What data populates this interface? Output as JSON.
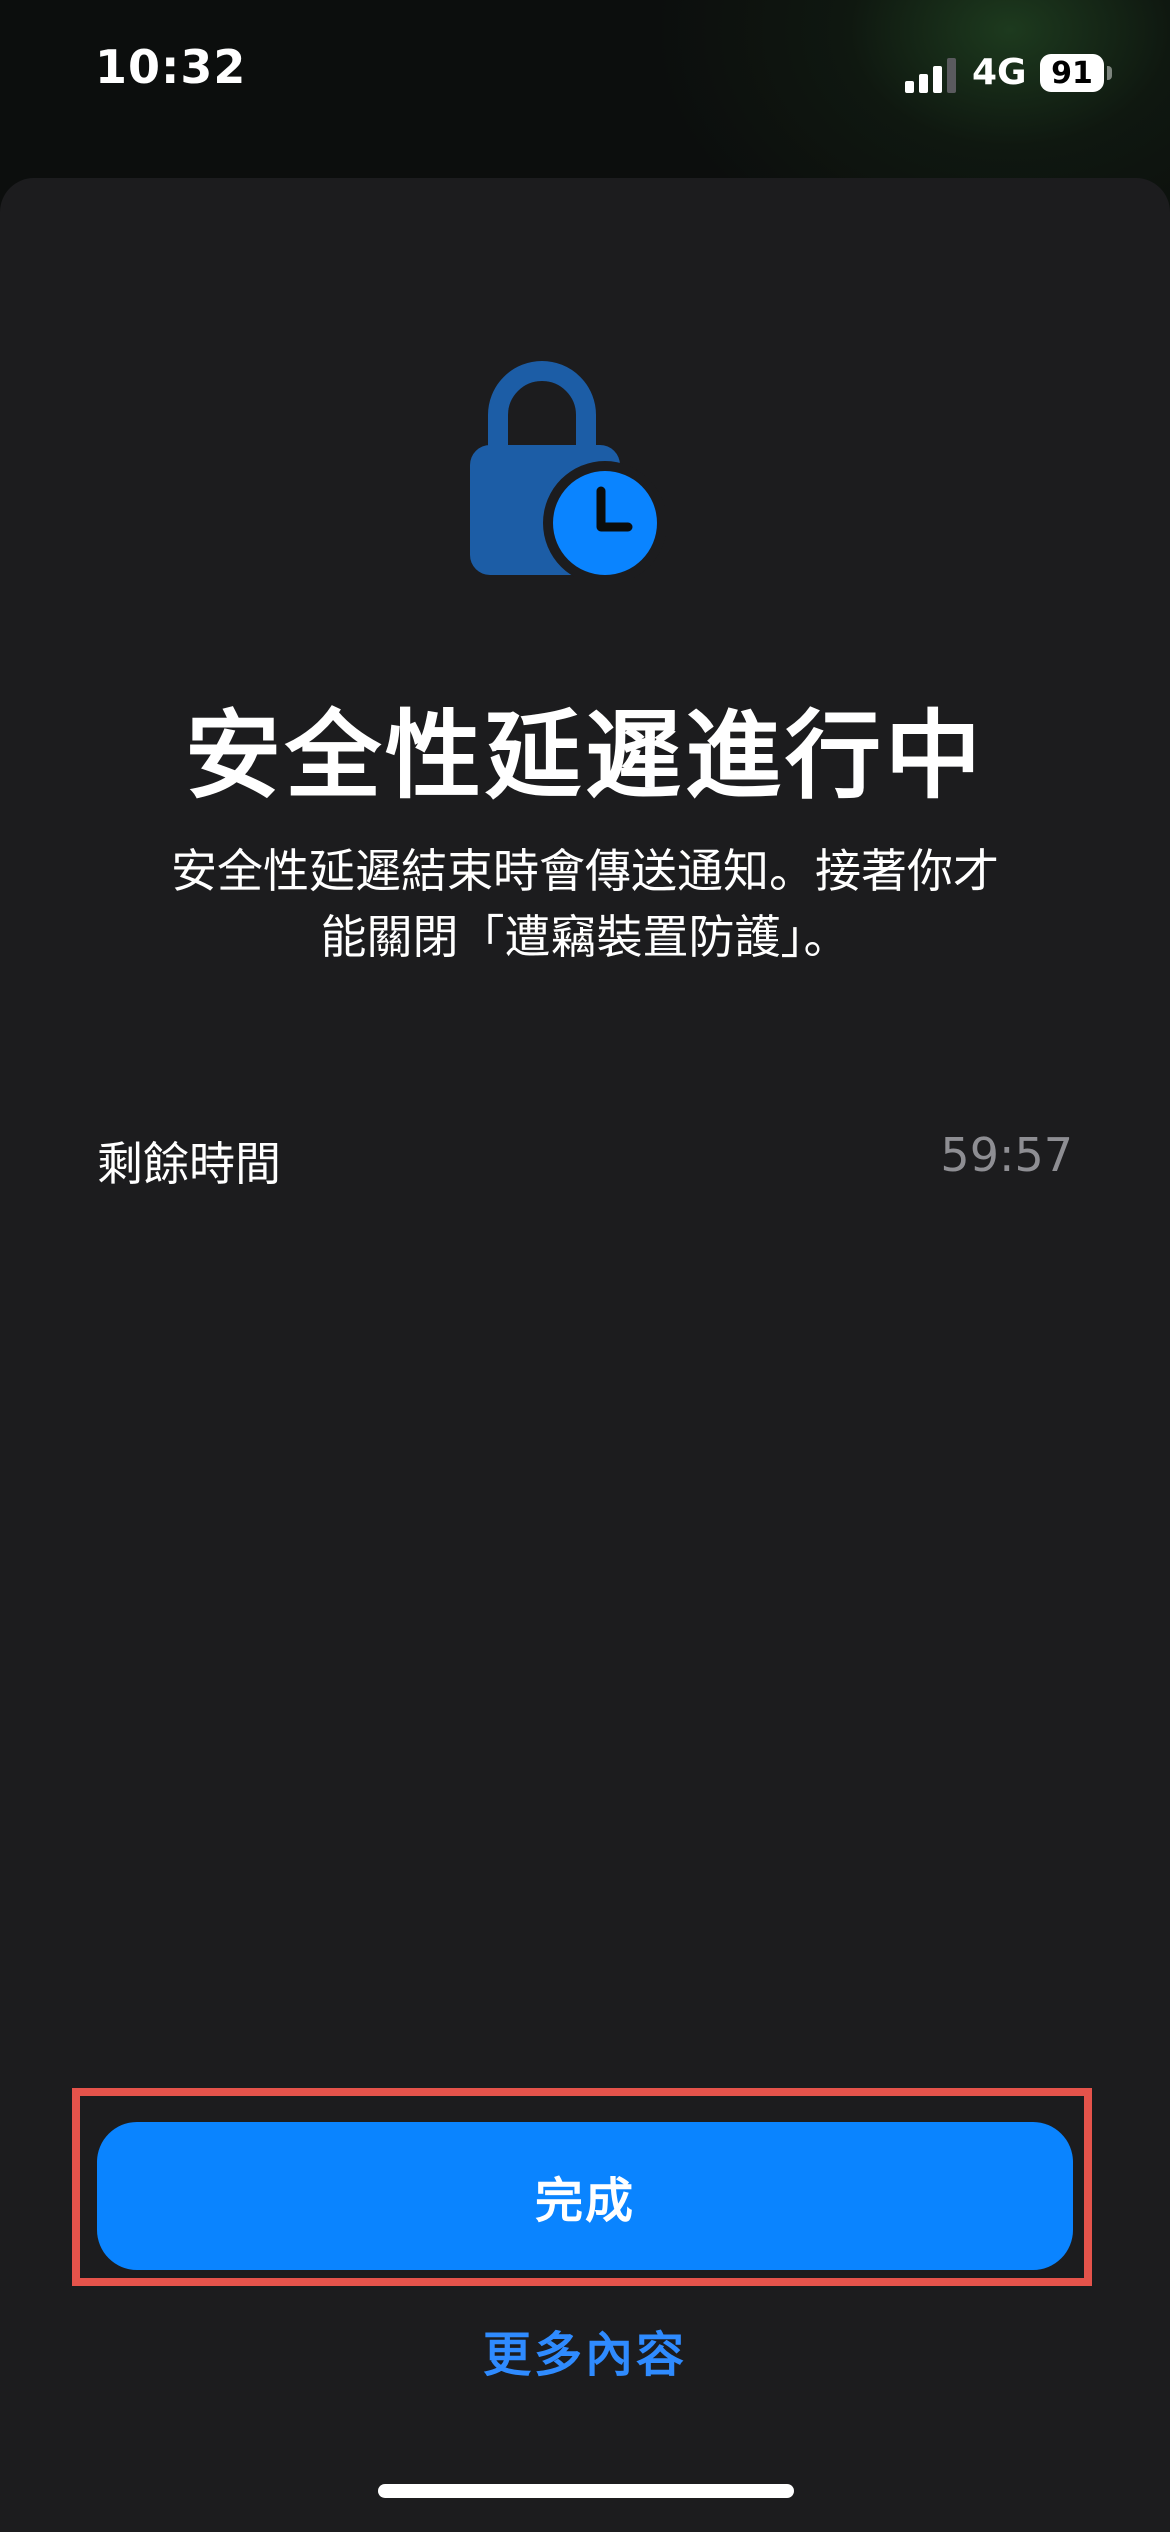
{
  "status_bar": {
    "time": "10:32",
    "network": "4G",
    "battery": "91",
    "signal_icon": "cellular-signal-icon",
    "battery_icon": "battery-icon"
  },
  "hero": {
    "icon": "lock-clock-icon",
    "lock_color": "#1c5da6",
    "clock_color": "#0a84ff"
  },
  "title": "安全性延遲進行中",
  "description": {
    "line1": "安全性延遲結束時會傳送通知。接著你才",
    "line2": "能關閉「遭竊裝置防護」。"
  },
  "remaining": {
    "label": "剩餘時間",
    "value": "59:57"
  },
  "actions": {
    "done_label": "完成",
    "more_label": "更多內容",
    "accent_color": "#0a84ff",
    "highlight_color": "#e5534b"
  }
}
